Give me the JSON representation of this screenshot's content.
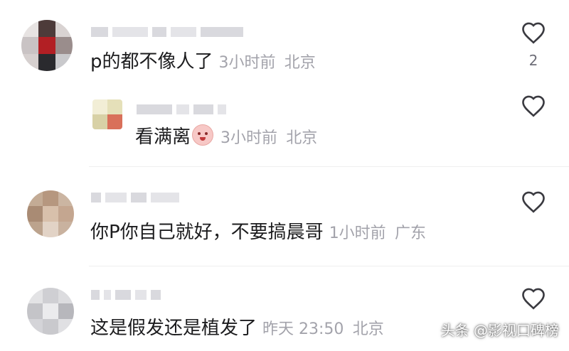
{
  "comments": [
    {
      "text": "p的都不像人了",
      "time": "3小时前",
      "location": "北京",
      "likes": "2",
      "reply": {
        "text": "看满离",
        "time": "3小时前",
        "location": "北京",
        "emoji": "blush-emoji"
      }
    },
    {
      "text": "你P你自己就好，不要搞晨哥",
      "time": "1小时前",
      "location": "广东"
    },
    {
      "text": "这是假发还是植发了",
      "time": "昨天 23:50",
      "location": "北京"
    }
  ],
  "watermark": "头条 @影视口碑榜",
  "icons": {
    "like": "heart-icon"
  },
  "colors": {
    "text": "#1c1c1e",
    "meta": "#a3a3ab"
  }
}
